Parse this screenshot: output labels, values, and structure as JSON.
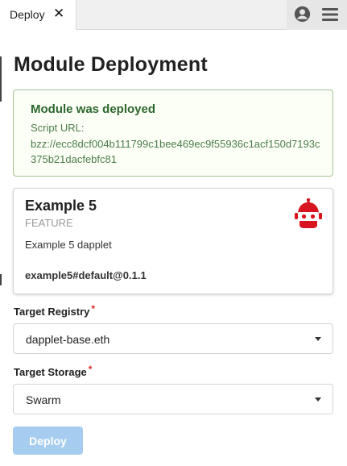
{
  "tab": {
    "label": "Deploy",
    "close_glyph": "✕"
  },
  "header": {
    "profile_icon": "user-circle-icon",
    "menu_icon": "hamburger-menu-icon"
  },
  "page": {
    "title": "Module Deployment"
  },
  "message": {
    "title": "Module was deployed",
    "label": "Script URL:",
    "url": "bzz://ecc8dcf004b111799c1bee469ec9f55936c1acf150d7193c375b21dacfebfc81",
    "color": "#2c662d",
    "background": "#fcfff5"
  },
  "module_card": {
    "title": "Example 5",
    "type": "FEATURE",
    "description": "Example 5 dapplet",
    "identifier": "example5#default@0.1.1",
    "icon": "red-robot-icon",
    "icon_color": "#d7141f"
  },
  "form": {
    "registry_label": "Target Registry",
    "registry_value": "dapplet-base.eth",
    "storage_label": "Target Storage",
    "storage_value": "Swarm",
    "required_mark": "*"
  },
  "actions": {
    "deploy_label": "Deploy",
    "deploy_color": "#a6cdef"
  }
}
